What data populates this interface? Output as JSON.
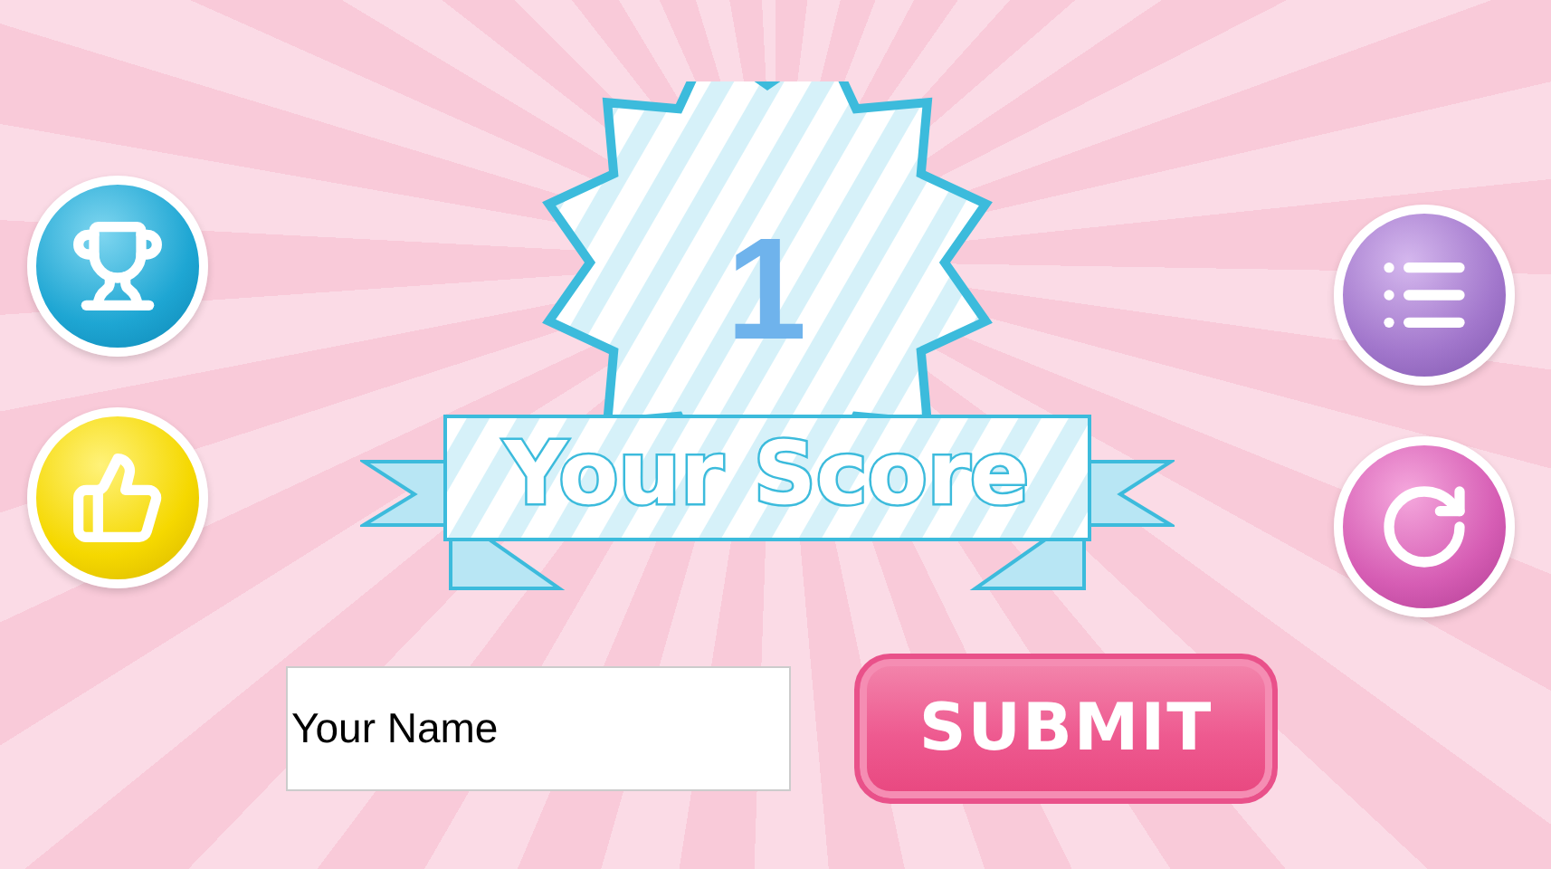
{
  "score": {
    "value": "1",
    "title": "Your Score"
  },
  "left_buttons": [
    {
      "kind": "trophy"
    },
    {
      "kind": "like"
    }
  ],
  "right_buttons": [
    {
      "kind": "list"
    },
    {
      "kind": "replay"
    }
  ],
  "name_field": {
    "value": "Your Name"
  },
  "submit": {
    "label": "SUBMIT"
  }
}
